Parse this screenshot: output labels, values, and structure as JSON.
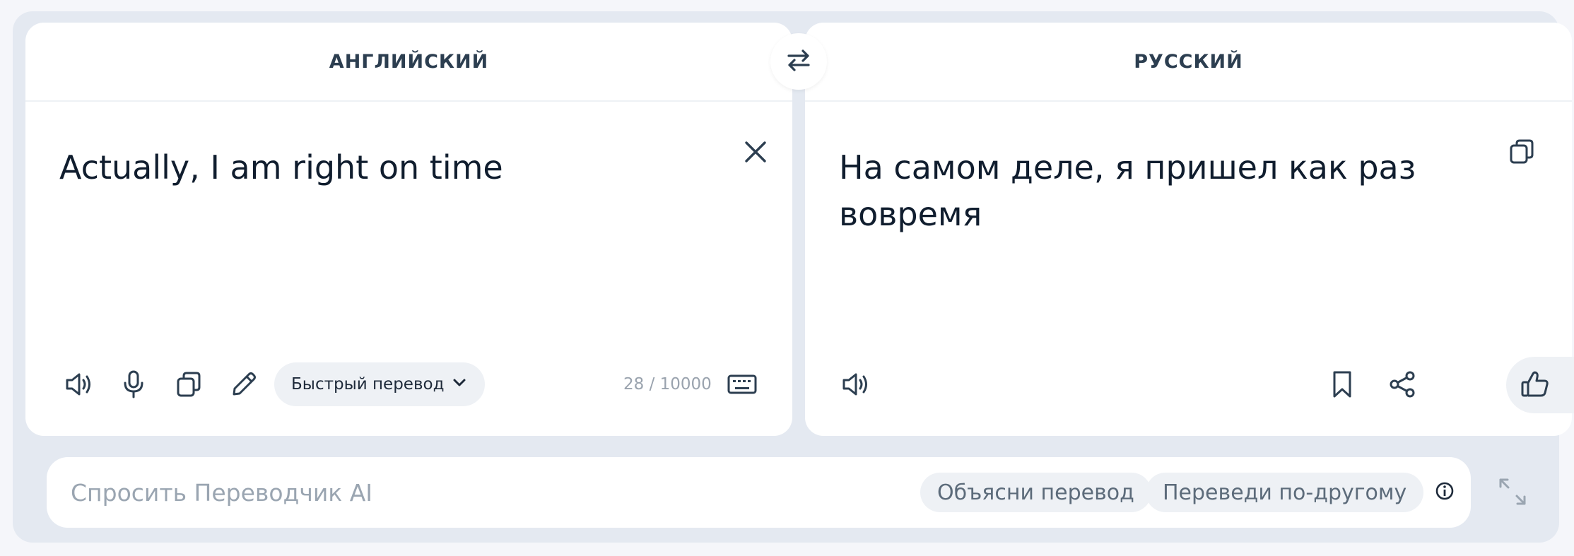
{
  "source": {
    "language": "АНГЛИЙСКИЙ",
    "text": "Actually, I am right on time",
    "mode_label": "Быстрый перевод",
    "counter": "28 / 10000"
  },
  "target": {
    "language": "РУССКИЙ",
    "text": "На самом деле, я пришел как раз вовремя"
  },
  "ai": {
    "placeholder": "Спросить Переводчик AI",
    "chip_explain": "Объясни перевод",
    "chip_rephrase": "Переведи по-другому"
  },
  "icons": {
    "swap": "swap-arrows-icon",
    "clear": "close-icon",
    "copy": "copy-icon",
    "speaker": "speaker-icon",
    "mic": "microphone-icon",
    "pencil": "pencil-icon",
    "keyboard": "keyboard-icon",
    "bookmark": "bookmark-icon",
    "share": "share-icon",
    "like": "thumbs-up-icon",
    "dislike": "thumbs-down-icon",
    "info": "info-icon",
    "expand": "expand-icon"
  },
  "colors": {
    "page_background": "#e4e9f1",
    "panel_background": "#ffffff",
    "pill_background": "#eef1f5",
    "text_primary": "#101d2e",
    "text_muted": "#9aa3ae"
  }
}
